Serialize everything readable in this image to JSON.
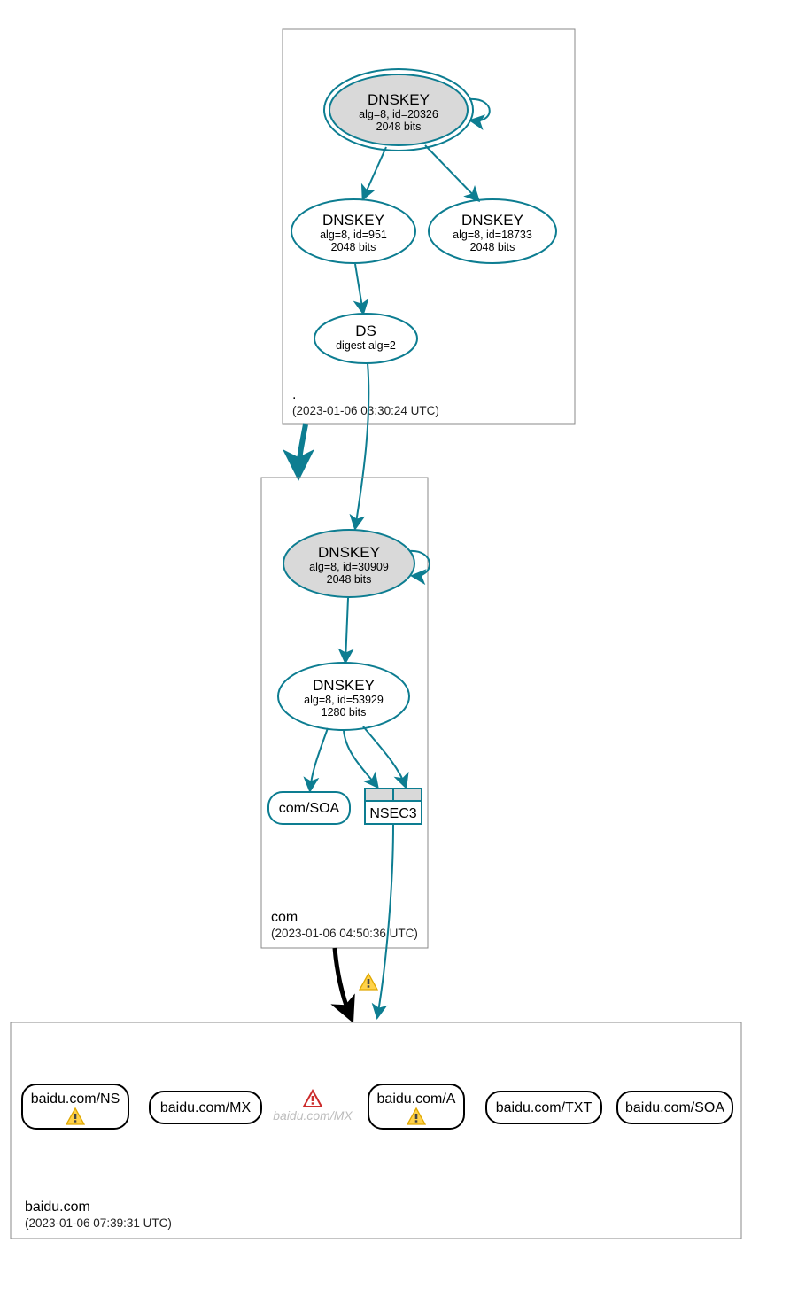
{
  "zones": {
    "root": {
      "name": ".",
      "timestamp": "(2023-01-06 03:30:24 UTC)"
    },
    "com": {
      "name": "com",
      "timestamp": "(2023-01-06 04:50:36 UTC)"
    },
    "baidu": {
      "name": "baidu.com",
      "timestamp": "(2023-01-06 07:39:31 UTC)"
    }
  },
  "nodes": {
    "root_ksk": {
      "title": "DNSKEY",
      "line1": "alg=8, id=20326",
      "line2": "2048 bits"
    },
    "root_zsk1": {
      "title": "DNSKEY",
      "line1": "alg=8, id=951",
      "line2": "2048 bits"
    },
    "root_zsk2": {
      "title": "DNSKEY",
      "line1": "alg=8, id=18733",
      "line2": "2048 bits"
    },
    "root_ds": {
      "title": "DS",
      "line1": "digest alg=2"
    },
    "com_ksk": {
      "title": "DNSKEY",
      "line1": "alg=8, id=30909",
      "line2": "2048 bits"
    },
    "com_zsk": {
      "title": "DNSKEY",
      "line1": "alg=8, id=53929",
      "line2": "1280 bits"
    },
    "com_soa": {
      "label": "com/SOA"
    },
    "com_nsec3": {
      "label": "NSEC3"
    },
    "b_ns": {
      "label": "baidu.com/NS"
    },
    "b_mx": {
      "label": "baidu.com/MX"
    },
    "b_mx_ghost": {
      "label": "baidu.com/MX"
    },
    "b_a": {
      "label": "baidu.com/A"
    },
    "b_txt": {
      "label": "baidu.com/TXT"
    },
    "b_soa": {
      "label": "baidu.com/SOA"
    }
  }
}
